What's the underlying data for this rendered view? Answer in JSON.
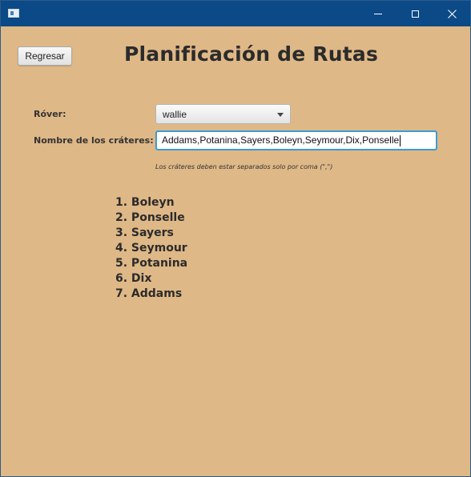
{
  "window": {
    "controls": {
      "minimize_icon": "minimize-icon",
      "maximize_icon": "maximize-icon",
      "close_icon": "close-icon",
      "close_glyph": "✕"
    },
    "colors": {
      "titlebar": "#0b4a86",
      "background": "#dfb887",
      "input_focus": "#3d9ad6"
    }
  },
  "toolbar": {
    "back_label": "Regresar"
  },
  "header": {
    "title": "Planificación de Rutas"
  },
  "form": {
    "rover_label": "Róver:",
    "rover_selected": "wallie",
    "craters_label": "Nombre de los cráteres:",
    "craters_value": "Addams,Potanina,Sayers,Boleyn,Seymour,Dix,Ponselle",
    "hint": "Los cráteres deben estar separados solo por coma (\",\")"
  },
  "route": {
    "items": [
      "1. Boleyn",
      "2. Ponselle",
      "3. Sayers",
      "4. Seymour",
      "5. Potanina",
      "6. Dix",
      "7. Addams"
    ]
  }
}
